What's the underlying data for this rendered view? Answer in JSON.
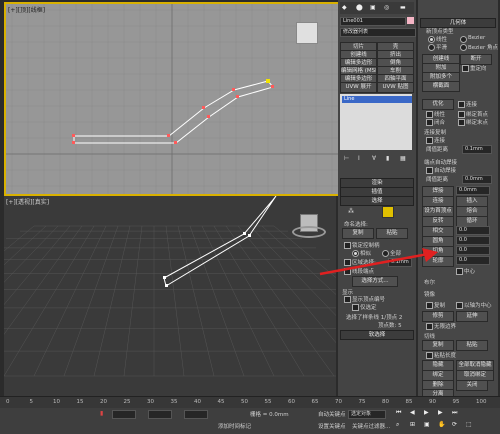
{
  "viewport_top": {
    "label": "[+][顶][线框]"
  },
  "viewport_persp": {
    "label": "[+][透视][真实]"
  },
  "modifier_panel": {
    "object_name": "Line001",
    "modifier_list": "修改器列表",
    "buttons": [
      "切片",
      "壳",
      "创建线",
      "挤出",
      "编辑多边形",
      "倒角",
      "编辑网格 (MSH)",
      "车削",
      "编辑多边形",
      "四轴平面",
      "UVW 展开",
      "UVW 贴图"
    ],
    "stack_item": "Line",
    "rollouts": {
      "render": "渲染",
      "interp": "插值",
      "select": "选择",
      "soft": "软选择"
    },
    "named_sel": "命名选择:",
    "copy": "复制",
    "paste": "粘贴",
    "lock_handles": "锁定控制柄",
    "similar": "相似",
    "all": "全部",
    "area_sel": "区域选择:",
    "area_val": "0.1mm",
    "segment_end": "线段端点",
    "sel_method": "选择方式...",
    "display": "显示",
    "show_vertex_num": "显示顶点编号",
    "only_selected": "仅选定",
    "status_line1": "选择了样条线 1/顶点 2",
    "status_line2": "顶点数: 5"
  },
  "geometry_panel": {
    "title": "几何体",
    "new_vertex_type": "新顶点类型",
    "linear": "线性",
    "bezier": "Bezier",
    "smooth": "平滑",
    "bezier_corner": "Bezier 角点",
    "create_line": "创建线",
    "break": "断开",
    "attach": "附加",
    "reorient": "重定向",
    "attach_mult": "附加多个",
    "cross_section": "横截面",
    "optimize": "优化",
    "connect": "连接",
    "linear2": "线性",
    "bind_first": "绑定首点",
    "closed": "闭合",
    "bind_last": "绑定末点",
    "connect_copy": "连接复制",
    "connect_label": "连接",
    "threshold": "阈值距离",
    "threshold_val": "0.1mm",
    "end_auto_weld": "端点自动焊接",
    "auto_weld": "自动焊接",
    "weld_threshold": "阈值距离",
    "weld_val": "0.0mm",
    "weld": "焊接",
    "connect2": "连接",
    "insert": "插入",
    "set_first": "设为首顶点",
    "fuse": "熔合",
    "reverse": "反转",
    "cycle": "循环",
    "intersect": "相交",
    "fillet": "圆角",
    "chamfer": "切角",
    "outline": "轮廓",
    "center": "中心",
    "boolean": "布尔",
    "mirror": "镜像",
    "copy": "复制",
    "about_pivot": "以轴为中心",
    "trim": "修剪",
    "extend": "延伸",
    "infinite_bounds": "无限边界",
    "tangent": "切线",
    "copy2": "复制",
    "paste2": "粘贴",
    "paste_length": "粘贴长度",
    "hide": "隐藏",
    "unhide_all": "全部取消隐藏",
    "bind": "绑定",
    "unbind": "取消绑定",
    "delete": "删除",
    "close": "关闭",
    "detach": "分离",
    "val_0mm": "0.0mm",
    "val_0": "0.0"
  },
  "timeline": {
    "ticks": [
      "0",
      "5",
      "10",
      "15",
      "20",
      "25",
      "30",
      "35",
      "40",
      "45",
      "50",
      "55",
      "60",
      "65",
      "70",
      "75",
      "80",
      "85",
      "90",
      "95",
      "100"
    ]
  },
  "status_bar": {
    "grid": "栅格 = 0.0mm",
    "add_time_tag": "添加时间标记",
    "auto_key": "自动关键点",
    "set_key": "设置关键点",
    "selected_obj": "选定对象",
    "key_filter": "关键点过滤器..."
  }
}
